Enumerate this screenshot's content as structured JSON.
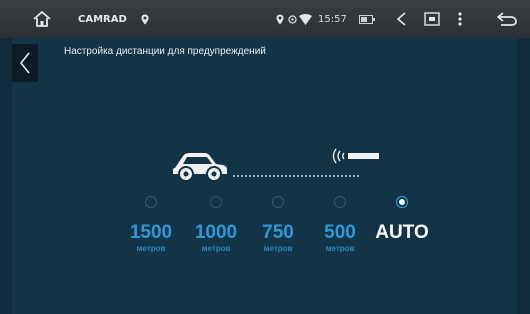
{
  "status_bar": {
    "app_name": "CAMRAD",
    "time": "15:57"
  },
  "screen": {
    "title": "Настройка дистанции для предупреждений"
  },
  "options": [
    {
      "value": "1500",
      "unit": "метров",
      "selected": false
    },
    {
      "value": "1000",
      "unit": "метров",
      "selected": false
    },
    {
      "value": "750",
      "unit": "метров",
      "selected": false
    },
    {
      "value": "500",
      "unit": "метров",
      "selected": false
    },
    {
      "value": "AUTO",
      "unit": "",
      "selected": true
    }
  ],
  "colors": {
    "accent": "#2a9ad8",
    "background": "#133347",
    "status_bar": "#33373b"
  },
  "icons": [
    "home-icon",
    "location-icon",
    "wifi-icon",
    "battery-icon",
    "volume-icon",
    "screenshot-icon",
    "menu-icon",
    "return-icon",
    "back-chevron-icon",
    "car-icon",
    "sensor-icon"
  ]
}
